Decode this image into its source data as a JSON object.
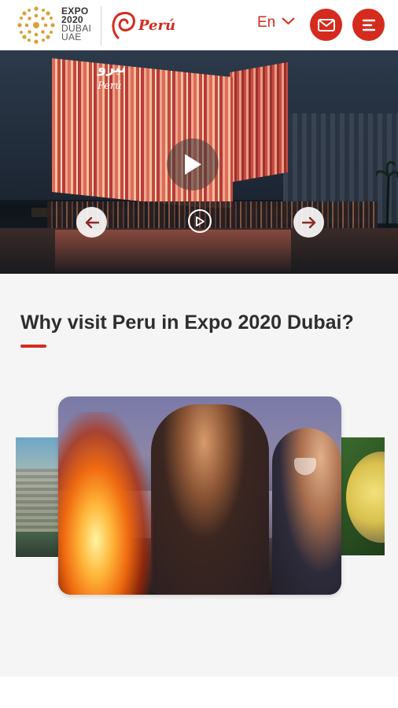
{
  "header": {
    "expo_logo": {
      "lines": [
        "EXPO",
        "2020",
        "DUBAI",
        "UAE"
      ],
      "icon": "expo-2020-sunburst-logo"
    },
    "peru_brand": {
      "text": "Perú",
      "icon": "peru-spiral-logo"
    },
    "language": {
      "label": "En",
      "icon": "chevron-down-icon"
    },
    "mail_button": {
      "icon": "envelope-icon"
    },
    "menu_button": {
      "icon": "hamburger-menu-icon"
    }
  },
  "hero": {
    "sign_arabic": "بيرو",
    "sign_brand": "Perú",
    "play_icon": "play-icon"
  },
  "section": {
    "title": "Why visit Peru in Expo 2020 Dubai?",
    "carousel": {
      "prev_icon": "arrow-left-icon",
      "next_icon": "arrow-right-icon",
      "video_icon": "play-circle-icon"
    }
  },
  "colors": {
    "brand_red": "#d52b1e",
    "section_bg": "#f5f5f5",
    "title_text": "#2e2e2e"
  }
}
